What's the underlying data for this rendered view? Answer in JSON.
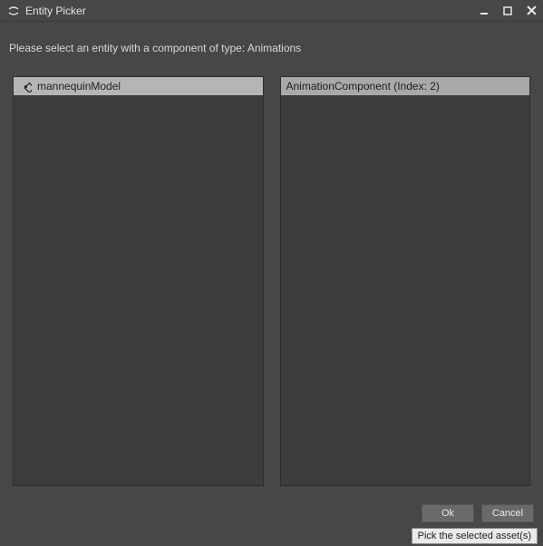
{
  "window": {
    "title": "Entity Picker"
  },
  "instruction": "Please select an entity with a component of type: Animations",
  "panels": {
    "left": {
      "header": "mannequinModel"
    },
    "right": {
      "header": "AnimationComponent (Index: 2)"
    }
  },
  "buttons": {
    "ok": "Ok",
    "cancel": "Cancel"
  },
  "tooltip": "Pick the selected asset(s)"
}
